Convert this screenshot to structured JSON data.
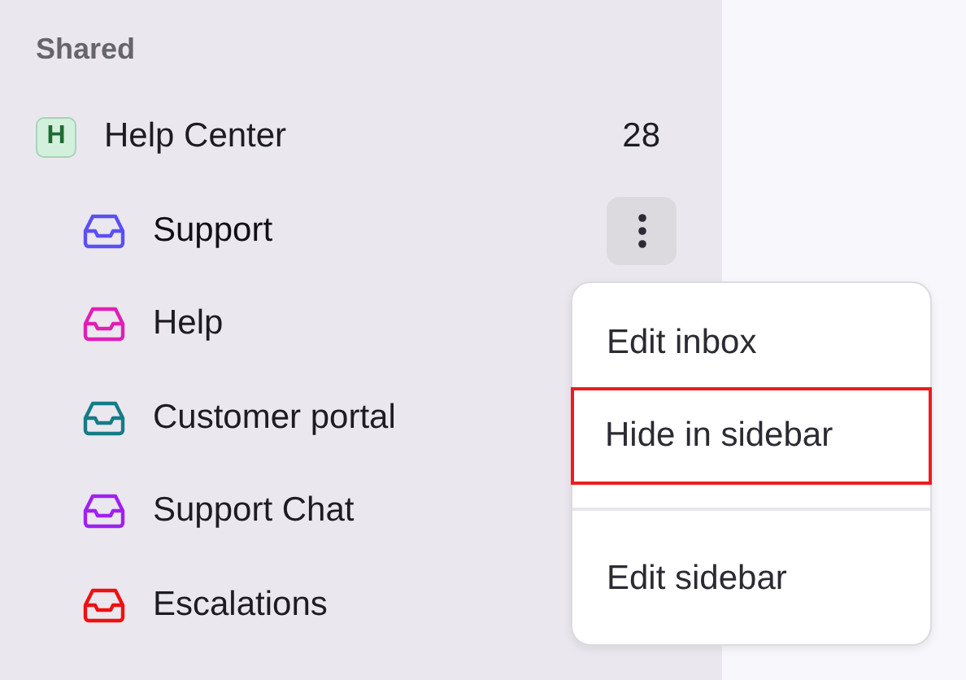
{
  "sidebar": {
    "section_title": "Shared",
    "group": {
      "badge": "H",
      "label": "Help Center",
      "count": "28"
    },
    "inboxes": [
      {
        "label": "Support",
        "color": "#5b4ff5",
        "hovered": true
      },
      {
        "label": "Help",
        "color": "#e01fb4",
        "hovered": false
      },
      {
        "label": "Customer portal",
        "color": "#167c86",
        "hovered": false
      },
      {
        "label": "Support Chat",
        "color": "#a020f0",
        "hovered": false
      },
      {
        "label": "Escalations",
        "color": "#ee1111",
        "hovered": false
      }
    ]
  },
  "menu": {
    "groups": [
      {
        "items": [
          {
            "label": "Edit inbox",
            "highlighted": false
          },
          {
            "label": "Hide in sidebar",
            "highlighted": true
          }
        ]
      },
      {
        "items": [
          {
            "label": "Edit sidebar",
            "highlighted": false
          }
        ]
      }
    ]
  }
}
